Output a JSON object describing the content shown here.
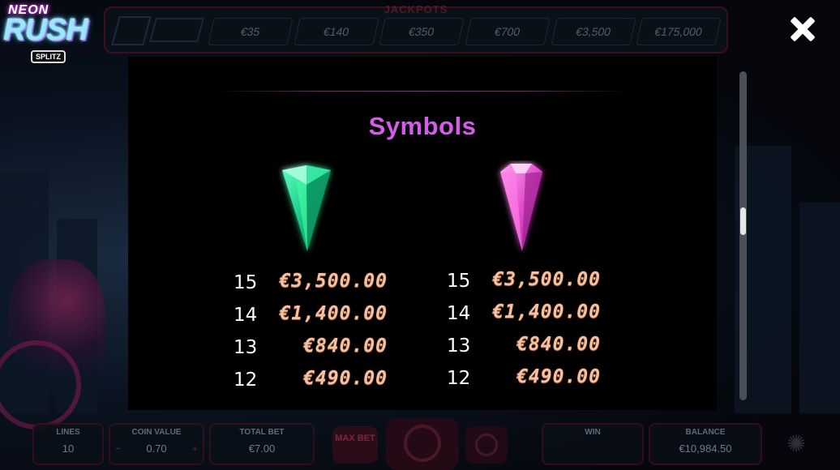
{
  "game": {
    "logo_line1": "NEON",
    "logo_line2": "RUSH",
    "logo_badge": "SPLITZ"
  },
  "jackpots": {
    "label": "JACKPOTS",
    "values": [
      "€35",
      "€140",
      "€350",
      "€700",
      "€3,500",
      "€175,000"
    ]
  },
  "controls": {
    "lines_label": "LINES",
    "lines_value": "10",
    "coin_label": "COIN VALUE",
    "coin_value": "0.70",
    "total_label": "TOTAL BET",
    "total_value": "€7.00",
    "maxbet_label": "MAX BET",
    "win_label": "WIN",
    "win_value": "",
    "balance_label": "BALANCE",
    "balance_value": "€10,984.50"
  },
  "paytable": {
    "title": "Symbols",
    "symbols": [
      {
        "icon": "green-crystal-icon",
        "color": "#29e08a",
        "rows": [
          {
            "count": "15",
            "amount": "€3,500.00"
          },
          {
            "count": "14",
            "amount": "€1,400.00"
          },
          {
            "count": "13",
            "amount": "€840.00"
          },
          {
            "count": "12",
            "amount": "€490.00"
          }
        ]
      },
      {
        "icon": "pink-crystal-icon",
        "color": "#f05bd6",
        "rows": [
          {
            "count": "15",
            "amount": "€3,500.00"
          },
          {
            "count": "14",
            "amount": "€1,400.00"
          },
          {
            "count": "13",
            "amount": "€840.00"
          },
          {
            "count": "12",
            "amount": "€490.00"
          }
        ]
      }
    ]
  },
  "colors": {
    "title": "#d55ce8",
    "amount": "#f2c2a2",
    "background": "#000000"
  },
  "scroll": {
    "position_fraction": 0.45
  }
}
